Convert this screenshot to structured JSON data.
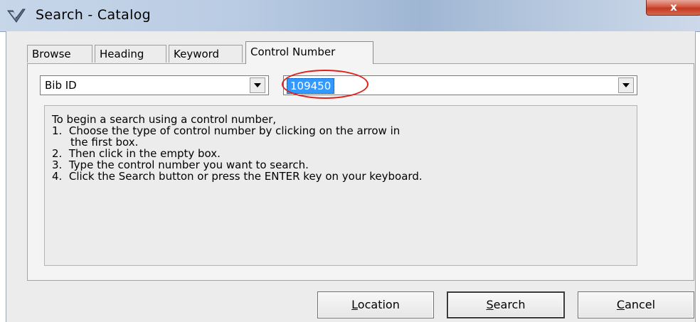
{
  "window": {
    "title": "Search - Catalog",
    "close_symbol": "x",
    "app_icon": "check-wing-icon"
  },
  "tabs": [
    {
      "label": "Browse",
      "active": false
    },
    {
      "label": "Heading",
      "active": false
    },
    {
      "label": "Keyword",
      "active": false
    },
    {
      "label": "Control Number",
      "active": true
    }
  ],
  "search": {
    "type_value": "Bib ID",
    "control_value": "109450"
  },
  "instructions": [
    "To begin a search using a control number,",
    "1.  Choose the type of control number by clicking on the arrow in",
    "the first box.",
    "2.  Then click in the empty box.",
    "3.  Type the control number you want to search.",
    "4.  Click the Search button or press the ENTER key on your keyboard."
  ],
  "buttons": {
    "location": {
      "label": "Location",
      "mnemonic": "L",
      "rest": "ocation"
    },
    "search": {
      "label": "Search",
      "mnemonic": "S",
      "rest": "earch"
    },
    "cancel": {
      "label": "Cancel",
      "mnemonic": "C",
      "rest": "ancel"
    }
  },
  "colors": {
    "highlight_ring": "#e0211a",
    "selection": "#3399ff",
    "close_button": "#c23a21"
  }
}
